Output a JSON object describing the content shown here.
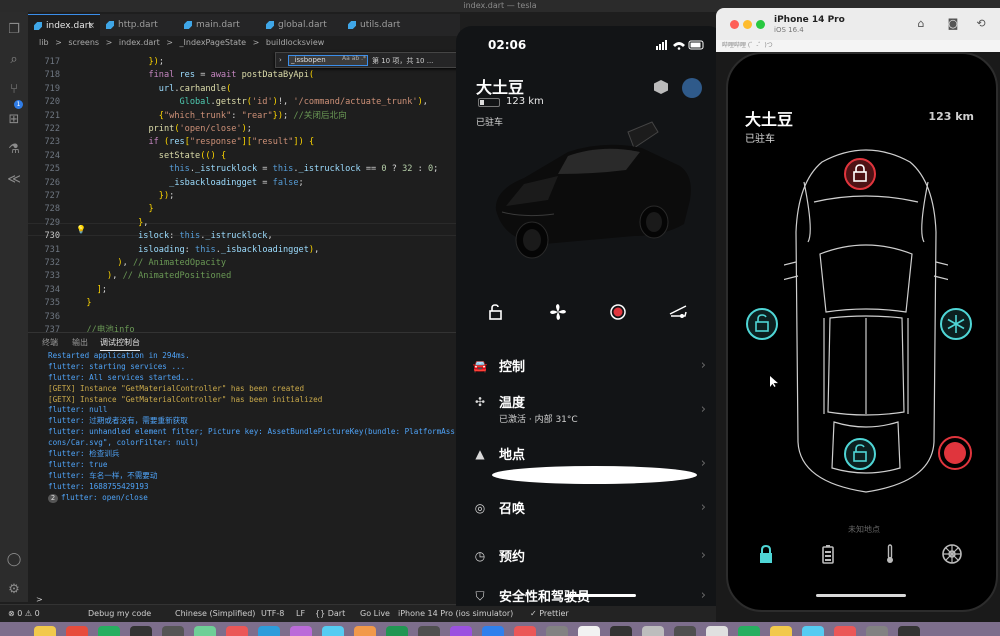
{
  "window": {
    "title": "index.dart — tesla"
  },
  "tabs": [
    {
      "label": "index.dart",
      "active": true
    },
    {
      "label": "http.dart",
      "active": false
    },
    {
      "label": "main.dart",
      "active": false
    },
    {
      "label": "global.dart",
      "active": false
    },
    {
      "label": "utils.dart",
      "active": false
    }
  ],
  "breadcrumb": [
    "lib",
    ">",
    "screens",
    ">",
    "index.dart",
    ">",
    "_IndexPageState",
    ">",
    "buildlocksview"
  ],
  "find": {
    "query": "_issbopen",
    "options": "Aa ab .*",
    "count": "第 10 项，共 10 ..."
  },
  "editor": {
    "lines": [
      {
        "n": "717",
        "code": "              });"
      },
      {
        "n": "718",
        "code": "              final res = await postDataByApi("
      },
      {
        "n": "719",
        "code": "                url.carhandle("
      },
      {
        "n": "720",
        "code": "                    Global.getstr('id')!, '/command/actuate_trunk'),"
      },
      {
        "n": "721",
        "code": "                {\"which_trunk\": \"rear\"}); //关闭后北向"
      },
      {
        "n": "722",
        "code": "              print('open/close');"
      },
      {
        "n": "723",
        "code": "              if (res[\"response\"][\"result\"]) {"
      },
      {
        "n": "724",
        "code": "                setState(() {"
      },
      {
        "n": "725",
        "code": "                  this._istrucklock = this._istrucklock == 0 ? 32 : 0;"
      },
      {
        "n": "726",
        "code": "                  _isbackloadingget = false;"
      },
      {
        "n": "727",
        "code": "                });"
      },
      {
        "n": "728",
        "code": "              }"
      },
      {
        "n": "729",
        "code": "            },"
      },
      {
        "n": "730",
        "code": "            islock: this._istrucklock,"
      },
      {
        "n": "731",
        "code": "            isloading: this._isbackloadingget),"
      },
      {
        "n": "732",
        "code": "        ), // AnimatedOpacity"
      },
      {
        "n": "733",
        "code": "      ), // AnimatedPositioned"
      },
      {
        "n": "734",
        "code": "    ];"
      },
      {
        "n": "735",
        "code": "  }"
      },
      {
        "n": "736",
        "code": ""
      },
      {
        "n": "737",
        "code": "  //电池info"
      }
    ]
  },
  "panel": {
    "tabs": [
      "终端",
      "输出",
      "调试控制台"
    ],
    "console": [
      {
        "text": "Restarted application in 294ms.",
        "type": "info"
      },
      {
        "text": "flutter: starting services ...",
        "type": "info"
      },
      {
        "text": "flutter: All services started...",
        "type": "info"
      },
      {
        "text": "[GETX] Instance \"GetMaterialController\" has been created",
        "type": "warn"
      },
      {
        "text": "[GETX] Instance \"GetMaterialController\" has been initialized",
        "type": "warn"
      },
      {
        "text": "flutter: null",
        "type": "info"
      },
      {
        "text": "flutter: 过期或者没有，需要重新获取",
        "type": "info"
      },
      {
        "text": "flutter: unhandled element filter; Picture key: AssetBundlePictureKey(bundle: PlatformAss",
        "type": "info"
      },
      {
        "text": "cons/Car.svg\", colorFilter: null)",
        "type": "info"
      },
      {
        "text": "flutter: 检查训兵",
        "type": "info"
      },
      {
        "text": "flutter: true",
        "type": "info"
      },
      {
        "text": "flutter: 车名一样，不需要动",
        "type": "info"
      },
      {
        "text": "flutter: 1688755429193",
        "type": "info"
      },
      {
        "text": "flutter: open/close",
        "type": "info",
        "count": "2"
      }
    ],
    "prompt": ">"
  },
  "statusbar": {
    "errors": "⊗ 0 ⚠ 0",
    "debug": "Debug my code",
    "lang": "Chinese (Simplified)",
    "encoding": "UTF-8",
    "eol": "LF",
    "mode": "{} Dart",
    "golive": "Go Live",
    "device": "iPhone 14 Pro (ios simulator)",
    "prettier": "✓ Prettier"
  },
  "app_left": {
    "time": "02:06",
    "car_name": "大土豆",
    "range": "123 km",
    "parked": "已驻车",
    "menu": [
      {
        "label": "控制",
        "sub": ""
      },
      {
        "label": "温度",
        "sub": "已激活 · 内部 31°C"
      },
      {
        "label": "地点",
        "sub": ""
      },
      {
        "label": "召唤",
        "sub": ""
      },
      {
        "label": "预约",
        "sub": ""
      },
      {
        "label": "安全性和驾驶员",
        "sub": ""
      }
    ]
  },
  "simulator": {
    "device": "iPhone 14 Pro",
    "os": "iOS 16.4",
    "background_snippet": "哔哩哔哩 (゜-゜)つ",
    "car_name": "大土豆",
    "parked": "已驻车",
    "range": "123 km",
    "unknown_location": "未知地点"
  },
  "colors": {
    "accent_red": "#e0353d",
    "accent_cyan": "#4fd6d6",
    "vscode_blue": "#3b8eea"
  }
}
